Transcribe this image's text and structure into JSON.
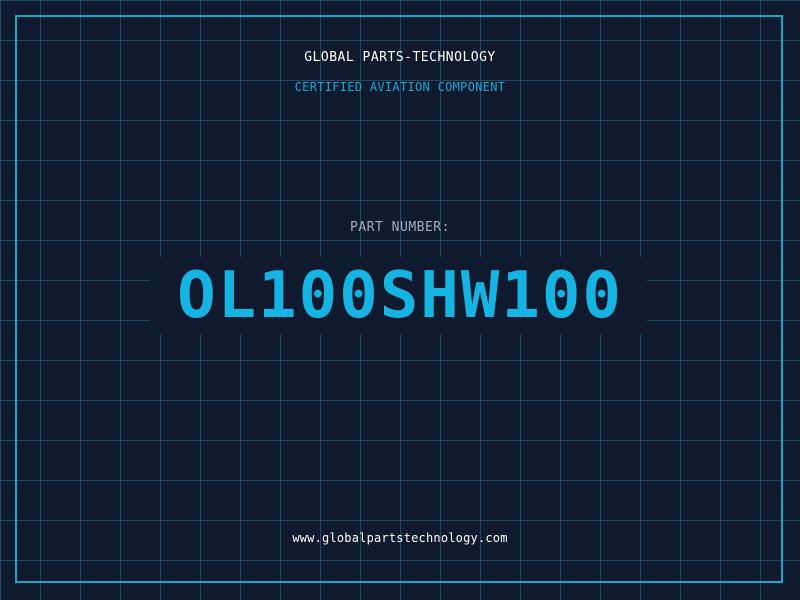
{
  "header": {
    "company": "GLOBAL PARTS-TECHNOLOGY",
    "subtitle": "CERTIFIED AVIATION COMPONENT"
  },
  "part": {
    "label": "PART NUMBER:",
    "number": "OL100SHW100"
  },
  "footer": {
    "website": "www.globalpartstechnology.com"
  },
  "colors": {
    "background": "#101a2e",
    "grid": "#1c4a62",
    "accent": "#19a6c9",
    "part_number": "#16b4e3",
    "label": "#a3aec0",
    "text": "#ffffff"
  }
}
